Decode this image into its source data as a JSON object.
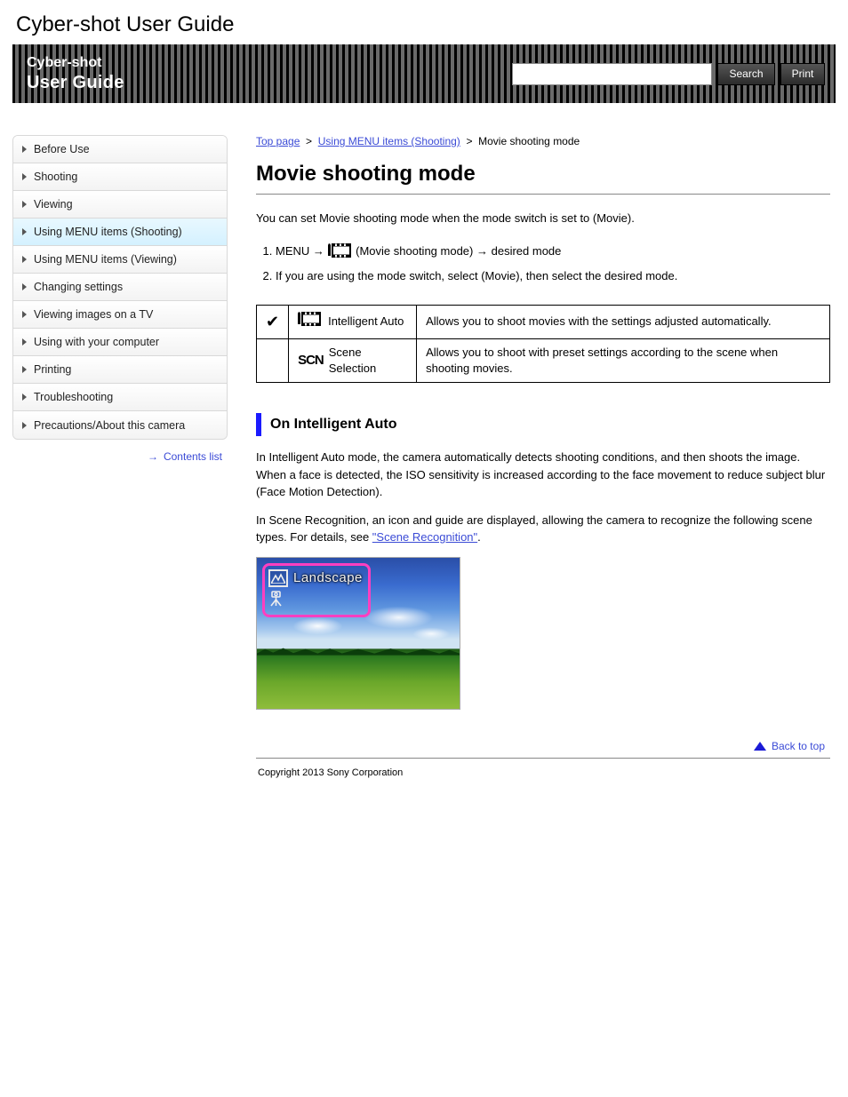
{
  "doc_title": "Cyber-shot User Guide",
  "header": {
    "line1": "Cyber-shot",
    "line2": "User Guide",
    "search_placeholder": "",
    "search_button": "Search",
    "print_button": "Print"
  },
  "sidebar": {
    "items": [
      {
        "label": "Before Use",
        "active": false
      },
      {
        "label": "Shooting",
        "active": false
      },
      {
        "label": "Viewing",
        "active": false
      },
      {
        "label": "Using MENU items (Shooting)",
        "active": true
      },
      {
        "label": "Using MENU items (Viewing)",
        "active": false
      },
      {
        "label": "Changing settings",
        "active": false
      },
      {
        "label": "Viewing images on a TV",
        "active": false
      },
      {
        "label": "Using with your computer",
        "active": false
      },
      {
        "label": "Printing",
        "active": false
      },
      {
        "label": "Troubleshooting",
        "active": false
      },
      {
        "label": "Precautions/About this camera",
        "active": false
      }
    ],
    "contents_link": "Contents list"
  },
  "breadcrumb": {
    "top": "Top page",
    "section": "Using MENU items (Shooting)",
    "page": "Movie shooting mode"
  },
  "page_title": "Movie shooting mode",
  "intro": "You can set Movie shooting mode when the mode switch is set to (Movie).",
  "step1_a": "MENU",
  "step1_b": "(Movie shooting mode)",
  "step1_c": "desired mode",
  "step2": "If you are using the mode switch, select (Movie), then select the desired mode.",
  "table": {
    "row1_label": "Intelligent Auto",
    "row1_desc": "Allows you to shoot movies with the settings adjusted automatically.",
    "row2_label": "Scene Selection",
    "row2_desc": "Allows you to shoot with preset settings according to the scene when shooting movies."
  },
  "ia": {
    "heading": "On Intelligent Auto",
    "para_a": "In Intelligent Auto mode, the camera automatically detects shooting conditions, and then shoots the image. When a face is detected, the ISO sensitivity is increased according to the face movement to reduce subject blur (Face Motion Detection).",
    "para_b_before": "In Scene Recognition, an icon and guide are displayed, allowing the camera to recognize the following scene types. For details, see ",
    "para_b_link": "\"Scene Recognition\"",
    "para_b_after": ".",
    "overlay_label": "Landscape"
  },
  "back_to_top": "Back to top",
  "copyright": "Copyright 2013 Sony Corporation"
}
